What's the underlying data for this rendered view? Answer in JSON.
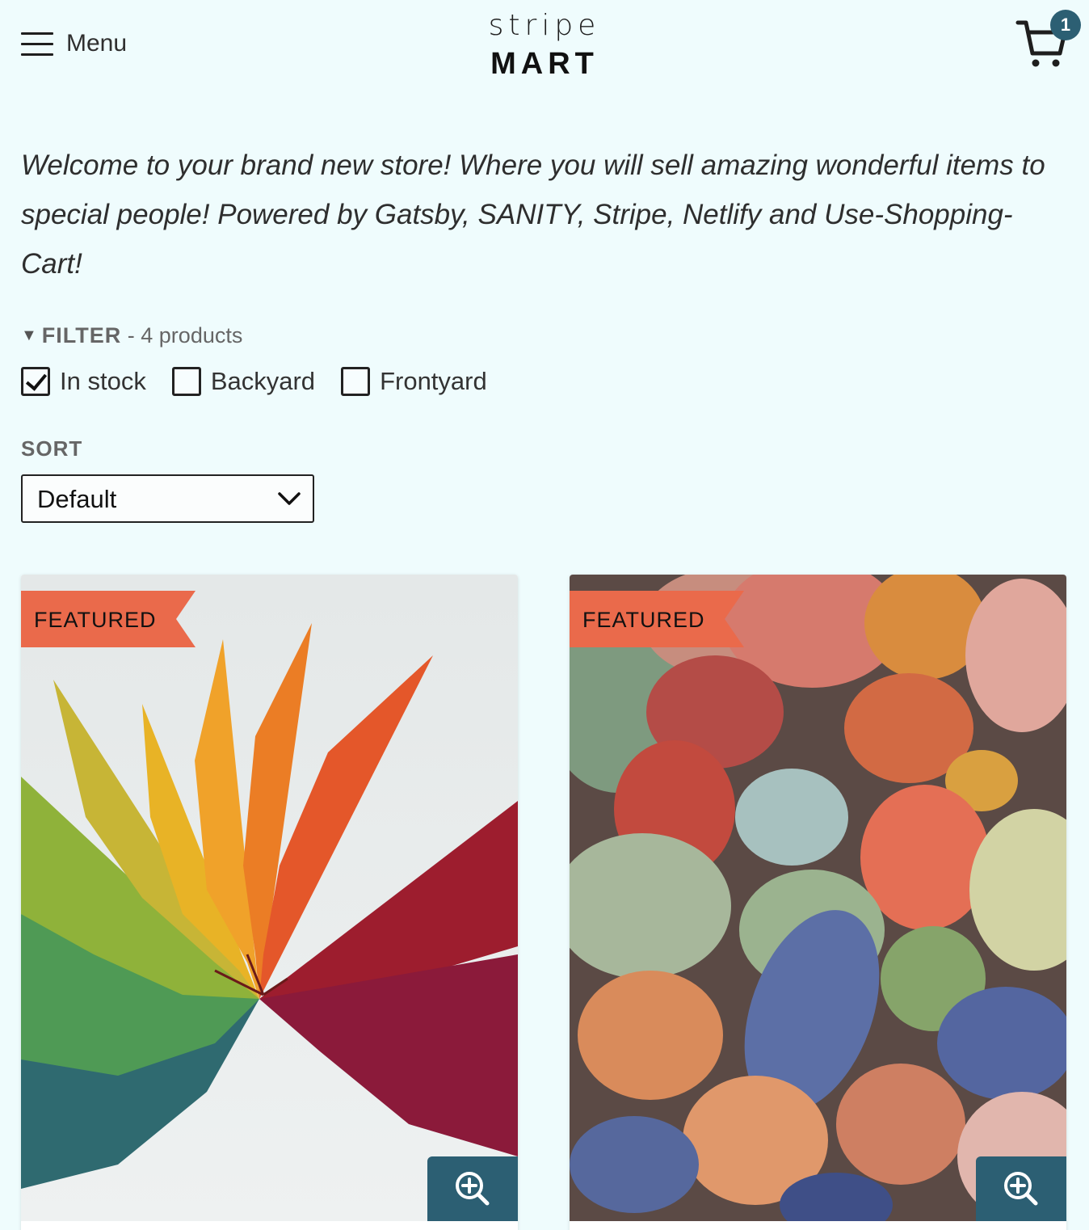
{
  "header": {
    "menu_label": "Menu",
    "logo_top": "stripe",
    "logo_bottom": "MART",
    "cart_count": "1"
  },
  "intro": {
    "text": "Welcome to your brand new store! Where you will sell amazing wonderful items to special people! Powered by Gatsby, SANITY, Stripe, Netlify and Use-Shopping-Cart!"
  },
  "filter": {
    "title": "FILTER",
    "count_text": " - 4 products",
    "options": [
      {
        "label": "In stock",
        "checked": true
      },
      {
        "label": "Backyard",
        "checked": false
      },
      {
        "label": "Frontyard",
        "checked": false
      }
    ]
  },
  "sort": {
    "label": "SORT",
    "selected": "Default"
  },
  "products": [
    {
      "badge": "FEATURED",
      "image": "autumn-leaves",
      "icon": "zoom-in-icon"
    },
    {
      "badge": "FEATURED",
      "image": "colorful-pebbles",
      "icon": "zoom-in-icon"
    }
  ],
  "colors": {
    "background": "#effcfd",
    "accent": "#2c5f73",
    "badge": "#ea6a4b"
  }
}
